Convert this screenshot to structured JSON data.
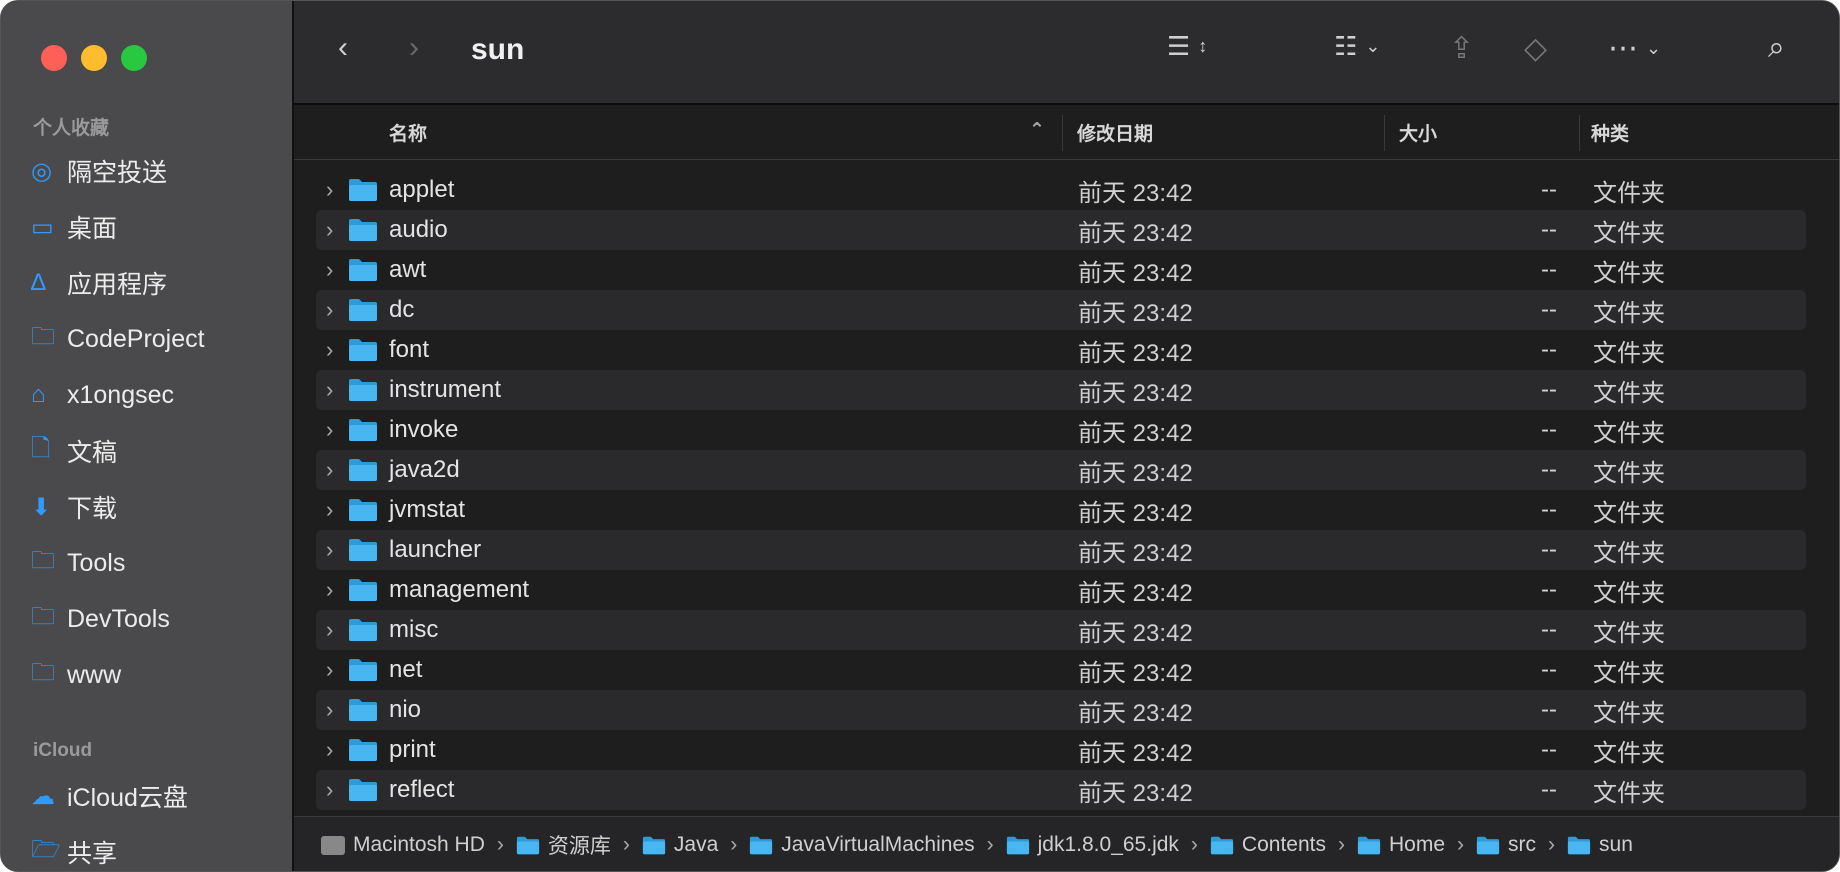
{
  "window": {
    "title": "sun"
  },
  "sidebar": {
    "favorites_label": "个人收藏",
    "favorites": [
      {
        "label": "隔空投送",
        "icon": "airdrop-icon"
      },
      {
        "label": "桌面",
        "icon": "desktop-icon"
      },
      {
        "label": "应用程序",
        "icon": "applications-icon"
      },
      {
        "label": "CodeProject",
        "icon": "folder-icon"
      },
      {
        "label": "x1ongsec",
        "icon": "home-icon"
      },
      {
        "label": "文稿",
        "icon": "document-icon"
      },
      {
        "label": "下载",
        "icon": "download-icon"
      },
      {
        "label": "Tools",
        "icon": "folder-icon"
      },
      {
        "label": "DevTools",
        "icon": "folder-icon"
      },
      {
        "label": "www",
        "icon": "folder-icon"
      }
    ],
    "icloud_label": "iCloud",
    "icloud": [
      {
        "label": "iCloud云盘",
        "icon": "cloud-icon"
      },
      {
        "label": "共享",
        "icon": "shared-folder-icon"
      }
    ]
  },
  "columns": {
    "name": "名称",
    "date": "修改日期",
    "size": "大小",
    "kind": "种类"
  },
  "files": [
    {
      "name": "applet",
      "date": "前天 23:42",
      "size": "--",
      "kind": "文件夹"
    },
    {
      "name": "audio",
      "date": "前天 23:42",
      "size": "--",
      "kind": "文件夹"
    },
    {
      "name": "awt",
      "date": "前天 23:42",
      "size": "--",
      "kind": "文件夹"
    },
    {
      "name": "dc",
      "date": "前天 23:42",
      "size": "--",
      "kind": "文件夹"
    },
    {
      "name": "font",
      "date": "前天 23:42",
      "size": "--",
      "kind": "文件夹"
    },
    {
      "name": "instrument",
      "date": "前天 23:42",
      "size": "--",
      "kind": "文件夹"
    },
    {
      "name": "invoke",
      "date": "前天 23:42",
      "size": "--",
      "kind": "文件夹"
    },
    {
      "name": "java2d",
      "date": "前天 23:42",
      "size": "--",
      "kind": "文件夹"
    },
    {
      "name": "jvmstat",
      "date": "前天 23:42",
      "size": "--",
      "kind": "文件夹"
    },
    {
      "name": "launcher",
      "date": "前天 23:42",
      "size": "--",
      "kind": "文件夹"
    },
    {
      "name": "management",
      "date": "前天 23:42",
      "size": "--",
      "kind": "文件夹"
    },
    {
      "name": "misc",
      "date": "前天 23:42",
      "size": "--",
      "kind": "文件夹"
    },
    {
      "name": "net",
      "date": "前天 23:42",
      "size": "--",
      "kind": "文件夹"
    },
    {
      "name": "nio",
      "date": "前天 23:42",
      "size": "--",
      "kind": "文件夹"
    },
    {
      "name": "print",
      "date": "前天 23:42",
      "size": "--",
      "kind": "文件夹"
    },
    {
      "name": "reflect",
      "date": "前天 23:42",
      "size": "--",
      "kind": "文件夹"
    }
  ],
  "path": [
    "Macintosh HD",
    "资源库",
    "Java",
    "JavaVirtualMachines",
    "jdk1.8.0_65.jdk",
    "Contents",
    "Home",
    "src",
    "sun"
  ],
  "colors": {
    "accent": "#2f9bff",
    "folder": "#3aa8e8"
  }
}
